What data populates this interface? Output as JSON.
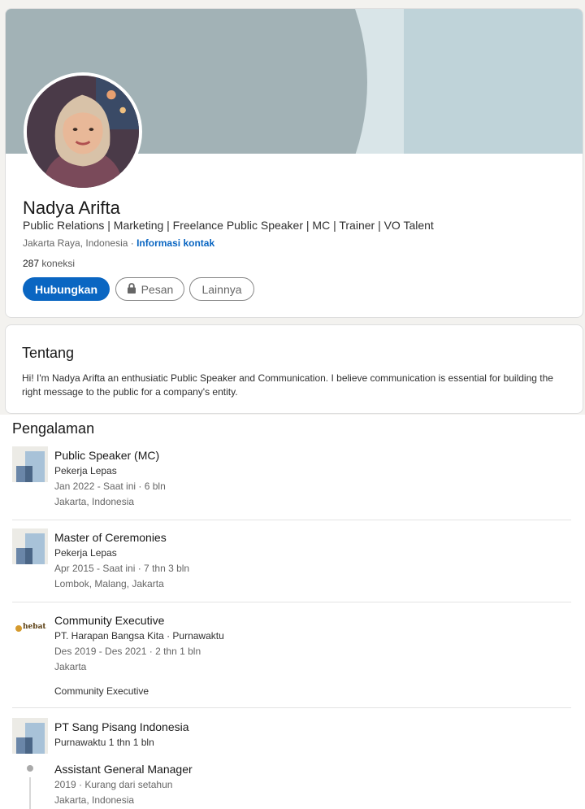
{
  "profile": {
    "name": "Nadya Arifta",
    "headline": "Public Relations | Marketing | Freelance Public Speaker | MC | Trainer | VO Talent",
    "location": "Jakarta Raya, Indonesia",
    "separator": " · ",
    "contact_link": "Informasi kontak",
    "connections_count": "287",
    "connections_label": "koneksi",
    "buttons": {
      "connect": "Hubungkan",
      "message": "Pesan",
      "more": "Lainnya"
    },
    "icons": {
      "message_button_icon": "lock-icon"
    }
  },
  "about": {
    "title": "Tentang",
    "text": "Hi! I'm Nadya Arifta an enthusiatic Public Speaker and Communication. I believe communication is essential for building the right message to the public for a company's entity."
  },
  "experience": {
    "title": "Pengalaman",
    "items": [
      {
        "role": "Public Speaker (MC)",
        "company": "Pekerja Lepas",
        "dates": "Jan 2022 - Saat ini · 6 bln",
        "place": "Jakarta, Indonesia",
        "logo": "placeholder-company-logo"
      },
      {
        "role": "Master of Ceremonies",
        "company": "Pekerja Lepas",
        "dates": "Apr 2015 - Saat ini · 7 thn 3 bln",
        "place": "Lombok, Malang, Jakarta",
        "logo": "placeholder-company-logo"
      },
      {
        "role": "Community Executive",
        "company": "PT. Harapan Bangsa Kita · Purnawaktu",
        "dates": "Des 2019 - Des 2021 · 2 thn 1 bln",
        "place": "Jakarta",
        "description": "Community Executive",
        "logo": "hebat-logo",
        "logo_text": "hebat"
      },
      {
        "company_group": "PT Sang Pisang Indonesia",
        "group_duration": "Purnawaktu 1 thn 1 bln",
        "logo": "placeholder-company-logo",
        "sub_role": "Assistant General Manager",
        "sub_dates": "2019 · Kurang dari setahun",
        "sub_place": "Jakarta, Indonesia"
      }
    ]
  },
  "colors": {
    "primary": "#0a66c2",
    "banner": "#bfd3d9",
    "banner_arc": "#a2b2b6",
    "page_bg": "#f3f2ef"
  }
}
